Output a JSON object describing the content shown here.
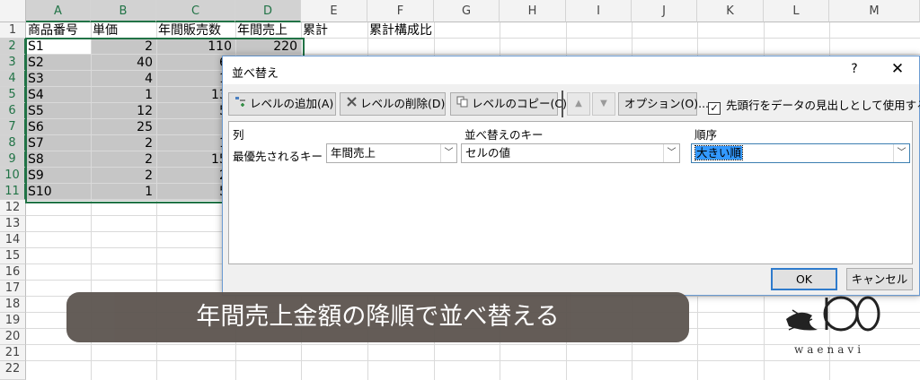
{
  "sheet": {
    "columns": [
      "A",
      "B",
      "C",
      "D",
      "E",
      "F",
      "G",
      "H",
      "I",
      "J",
      "K",
      "L",
      "M"
    ],
    "rows": [
      "1",
      "2",
      "3",
      "4",
      "5",
      "6",
      "7",
      "8",
      "9",
      "10",
      "11",
      "12",
      "13",
      "14",
      "15",
      "16",
      "17",
      "18",
      "19",
      "20",
      "21",
      "22"
    ],
    "headers": {
      "a": "商品番号",
      "b": "単価",
      "c": "年間販売数",
      "d": "年間売上",
      "e": "累計",
      "f": "累計構成比"
    },
    "data": [
      {
        "a": "S1",
        "b": "2",
        "c": "110",
        "d": "220"
      },
      {
        "a": "S2",
        "b": "40",
        "c": "6"
      },
      {
        "a": "S3",
        "b": "4",
        "c": "1"
      },
      {
        "a": "S4",
        "b": "1",
        "c": "13"
      },
      {
        "a": "S5",
        "b": "12",
        "c": "5"
      },
      {
        "a": "S6",
        "b": "25",
        "c": ""
      },
      {
        "a": "S7",
        "b": "2",
        "c": "1"
      },
      {
        "a": "S8",
        "b": "2",
        "c": "15"
      },
      {
        "a": "S9",
        "b": "2",
        "c": "2"
      },
      {
        "a": "S10",
        "b": "1",
        "c": "5"
      }
    ]
  },
  "dialog": {
    "title": "並べ替え",
    "help": "?",
    "close": "✕",
    "toolbar": {
      "add_level": "レベルの追加(A)",
      "delete_level": "レベルの削除(D)",
      "copy_level": "レベルのコピー(C)",
      "options": "オプション(O)...",
      "header_checkbox_label": "先頭行をデータの見出しとして使用する(H)",
      "header_checkbox_checked": true
    },
    "columns": {
      "column": "列",
      "sort_on": "並べ替えのキー",
      "order": "順序"
    },
    "level": {
      "label": "最優先されるキー",
      "column_value": "年間売上",
      "sort_on_value": "セルの値",
      "order_value": "大きい順"
    },
    "ok": "OK",
    "cancel": "キャンセル"
  },
  "caption": "年間売上金額の降順で並べ替える",
  "logo_text": "waenavi",
  "colors": {
    "excel_green": "#217346",
    "selection_gray": "#c6c6c6",
    "caption_bg": "#5e5651",
    "dialog_border": "#6b9bd2"
  }
}
